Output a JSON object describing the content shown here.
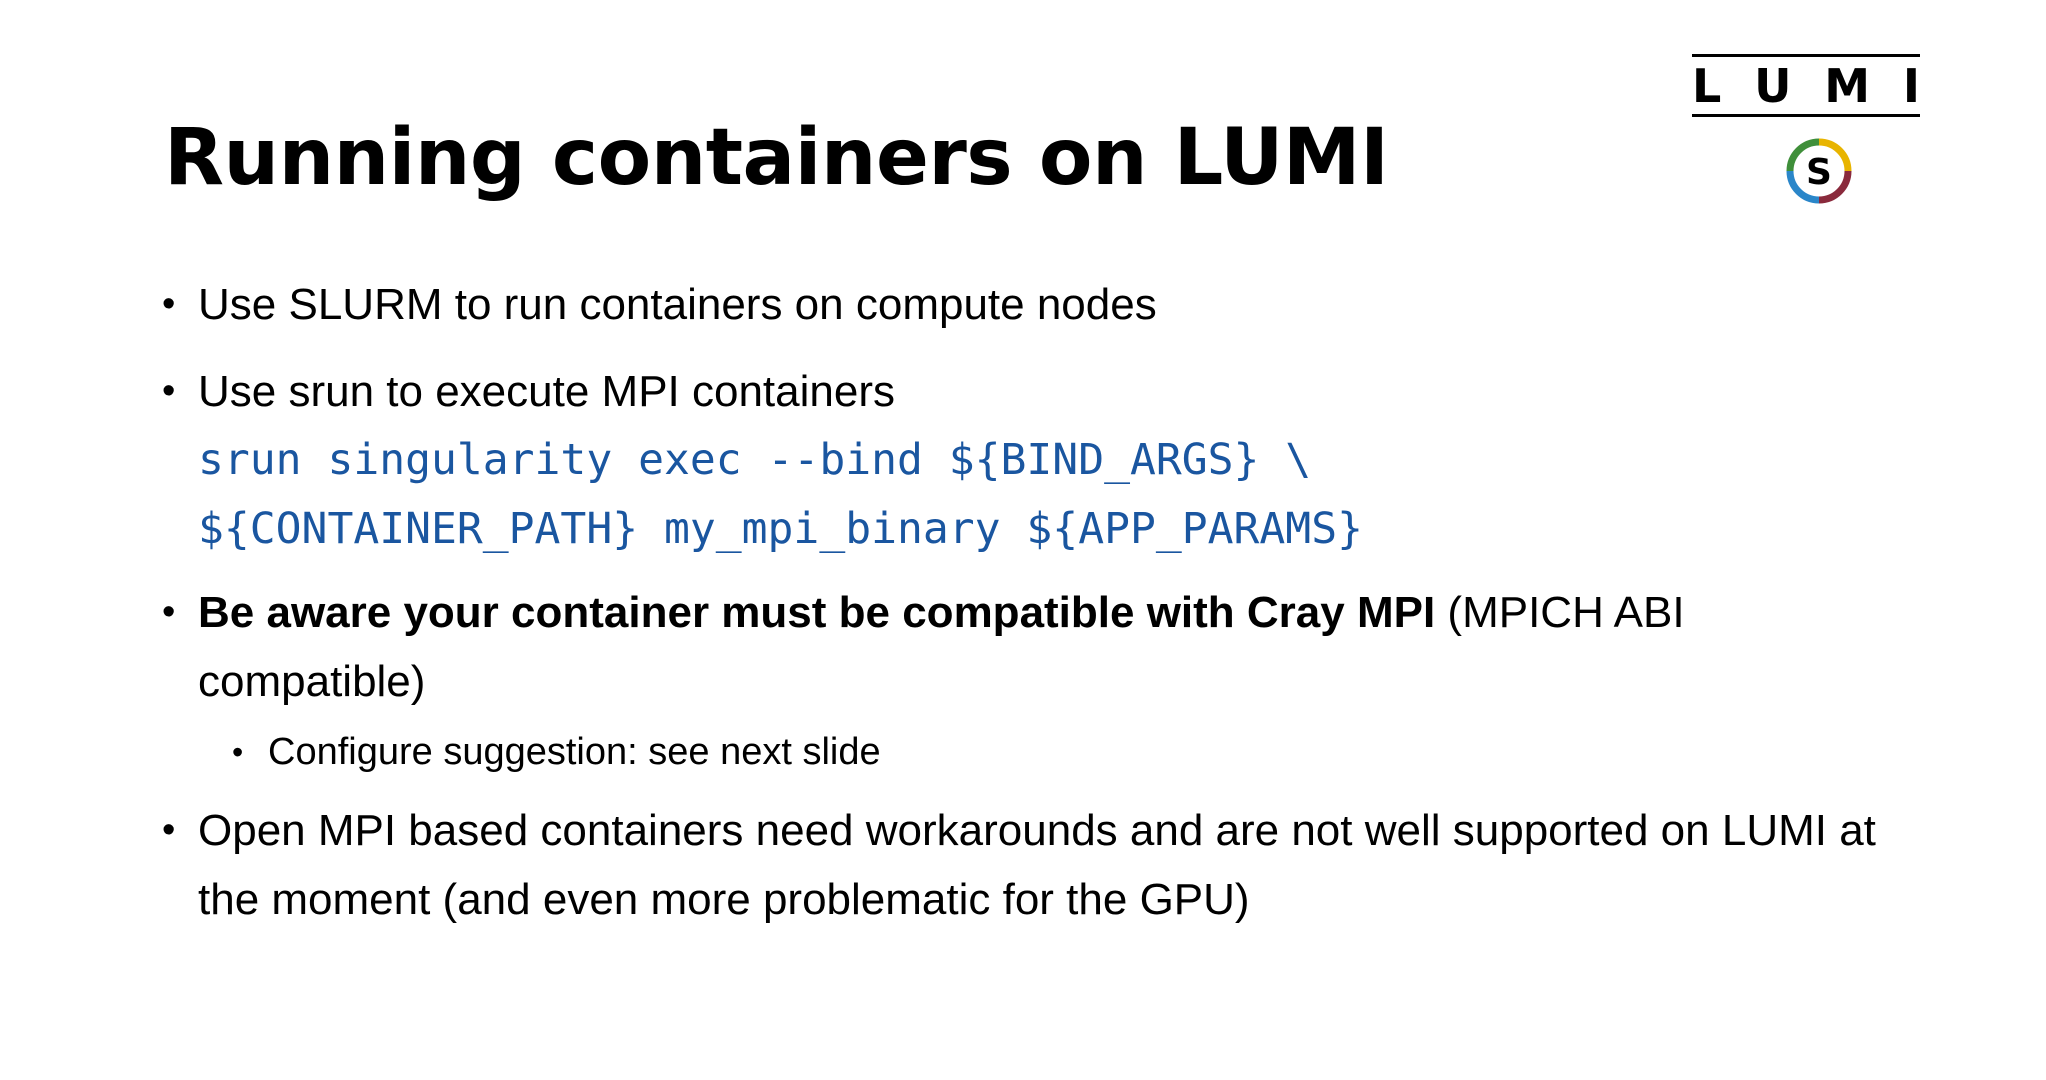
{
  "slide": {
    "title": "Running containers on LUMI",
    "logo": {
      "letters": [
        "L",
        "U",
        "M",
        "I"
      ],
      "mark_letter": "S",
      "mark_colors": [
        "#e8b400",
        "#8a2a3c",
        "#3f8f3a",
        "#2a86c9"
      ]
    },
    "bullets": [
      {
        "text": "Use SLURM to run containers on compute nodes"
      },
      {
        "text": "Use srun to execute MPI containers",
        "code_line1": "srun singularity exec --bind ${BIND_ARGS} \\",
        "code_line2": "${CONTAINER_PATH} my_mpi_binary ${APP_PARAMS}",
        "code_color": "#1a56a0"
      },
      {
        "bold_text": "Be aware your container must be compatible with Cray MPI",
        "text": " (MPICH ABI compatible)",
        "sub_bullet": "Configure suggestion: see next slide"
      },
      {
        "text": "Open MPI based containers need workarounds and are not well supported on LUMI at the moment (and even more problematic for the GPU)"
      }
    ],
    "bullet_glyph": "•"
  }
}
